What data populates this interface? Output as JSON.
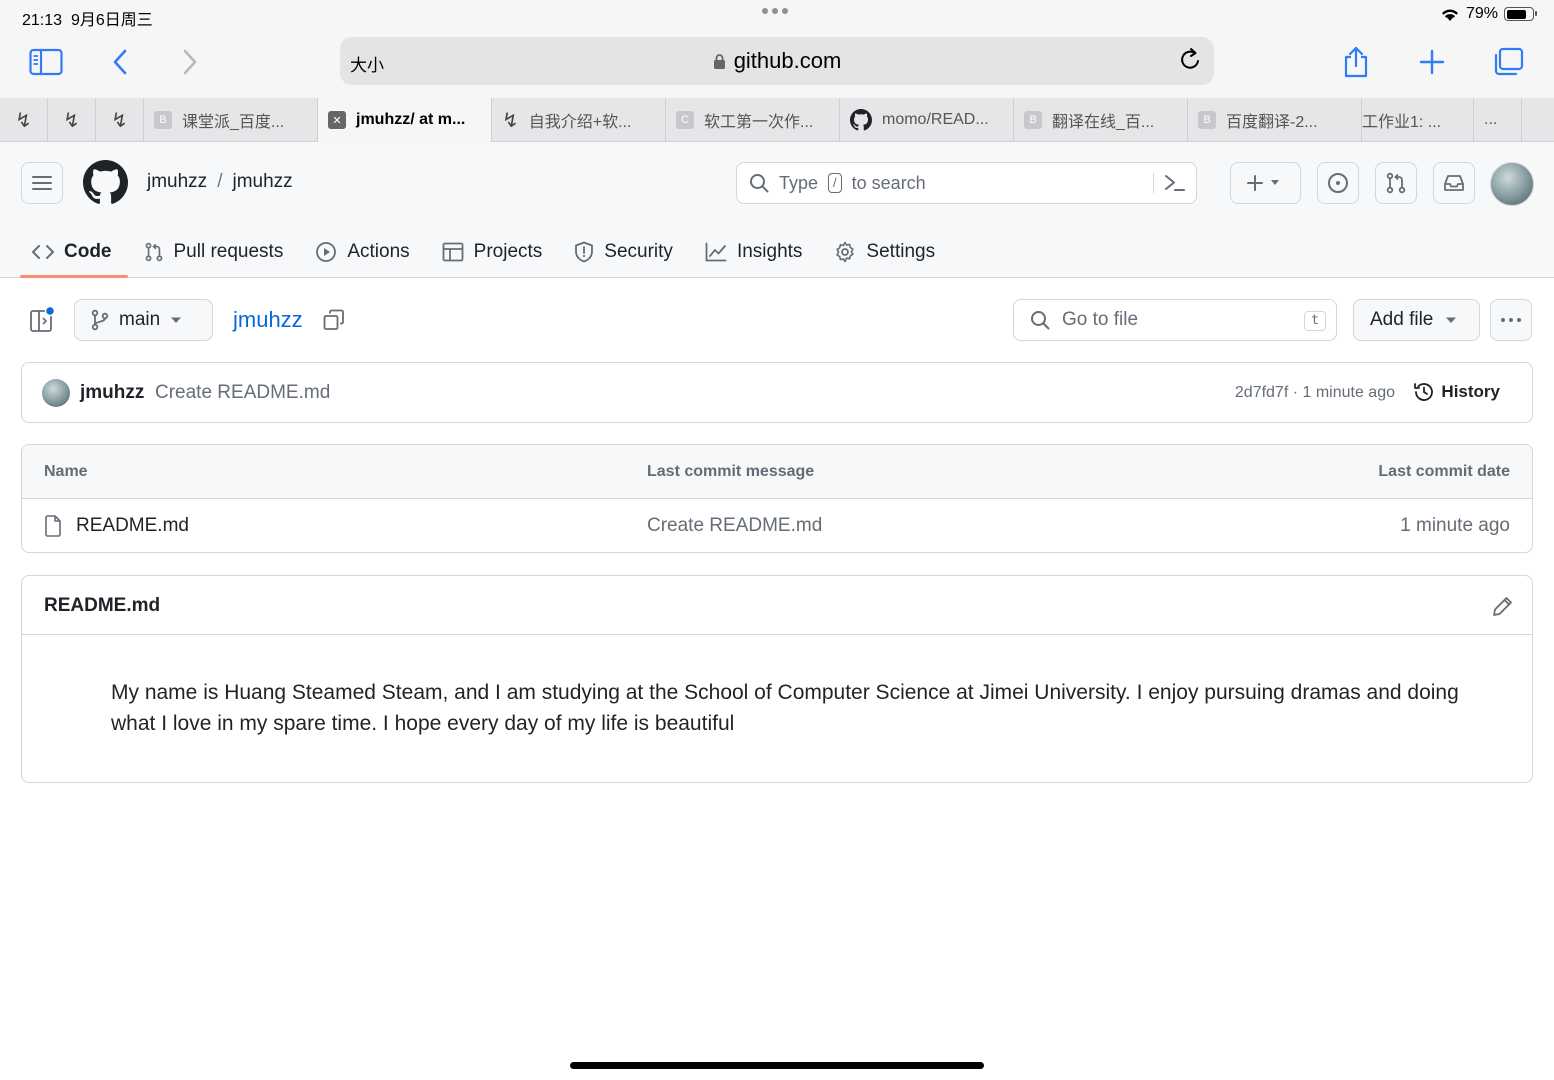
{
  "status_bar": {
    "time": "21:13",
    "date": "9月6日周三",
    "battery": "79%",
    "battery_fraction": 0.79
  },
  "browser": {
    "text_size_label": "大小",
    "url": "github.com",
    "tabs": [
      {
        "label": "",
        "favicon": "yuque-icon"
      },
      {
        "label": "",
        "favicon": "yuque-icon"
      },
      {
        "label": "",
        "favicon": "yuque-icon"
      },
      {
        "label": "课堂派_百度...",
        "favicon": "B"
      },
      {
        "label": "jmuhzz/ at m...",
        "favicon": "close-icon",
        "active": true
      },
      {
        "label": "自我介绍+软...",
        "favicon": "yuque-icon"
      },
      {
        "label": "软工第一次作...",
        "favicon": "C"
      },
      {
        "label": "momo/READ...",
        "favicon": "github-icon"
      },
      {
        "label": "翻译在线_百...",
        "favicon": "B"
      },
      {
        "label": "百度翻译-2...",
        "favicon": "B"
      },
      {
        "label": "工作业1: ...",
        "favicon": ""
      },
      {
        "label": "...",
        "favicon": ""
      }
    ]
  },
  "github": {
    "breadcrumb": {
      "owner": "jmuhzz",
      "separator": "/",
      "repo": "jmuhzz"
    },
    "search": {
      "prefix": "Type",
      "key": "/",
      "suffix": "to search"
    },
    "nav": {
      "code": "Code",
      "pulls": "Pull requests",
      "actions": "Actions",
      "projects": "Projects",
      "security": "Security",
      "insights": "Insights",
      "settings": "Settings"
    },
    "branch": "main",
    "repo_title": "jmuhzz",
    "go_to_file": {
      "placeholder": "Go to file",
      "shortcut": "t"
    },
    "add_file": "Add file",
    "commit": {
      "author": "jmuhzz",
      "message": "Create README.md",
      "meta": "2d7fd7f · 1 minute ago",
      "history": "History"
    },
    "table": {
      "headers": {
        "name": "Name",
        "message": "Last commit message",
        "date": "Last commit date"
      },
      "rows": [
        {
          "name": "README.md",
          "message": "Create README.md",
          "date": "1 minute ago"
        }
      ]
    },
    "readme": {
      "title": "README.md",
      "body": "My name is Huang Steamed Steam, and I am studying at the School of Computer Science at Jimei University. I enjoy pursuing dramas and doing what I love in my spare time. I hope every day of my life is beautiful"
    }
  },
  "colors": {
    "link": "#0969da",
    "tab_underline": "#fd8c73",
    "border": "#d0d7de",
    "ios_blue": "#2f7cf6"
  }
}
